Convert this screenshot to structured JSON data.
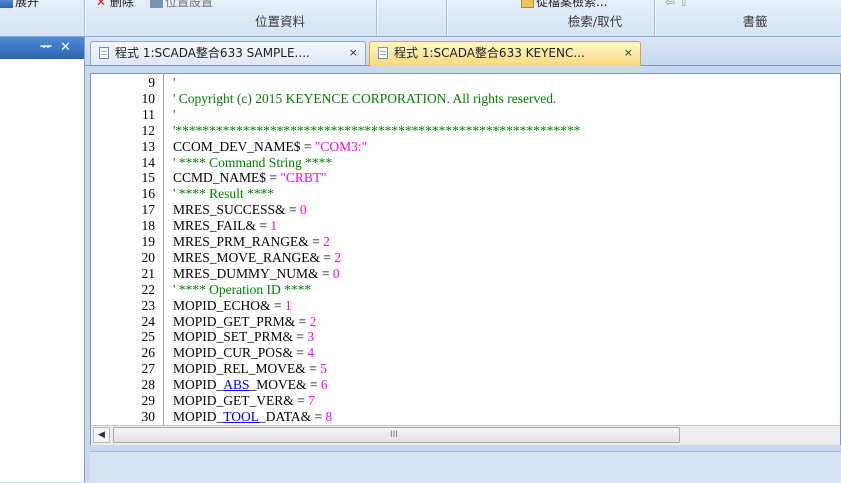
{
  "ribbon": {
    "expand_label": "展开",
    "delete_label": "删除",
    "set_position_label": "位置設置",
    "bookmark_label": "從檔案檢索...",
    "group_position": "位置資料",
    "group_search": "檢索/取代",
    "group_bookmark": "書籤"
  },
  "left_pane": {
    "pin_label": "ᅲ",
    "close_label": "✕"
  },
  "tabs": [
    {
      "title": "程式 1:SCADA整合633 SAMPLE....",
      "close": "×",
      "active": false
    },
    {
      "title": "程式 1:SCADA整合633 KEYENC...",
      "close": "×",
      "active": true
    }
  ],
  "editor": {
    "lines": [
      {
        "n": "9",
        "tokens": [
          {
            "t": "'",
            "c": "comment"
          }
        ]
      },
      {
        "n": "10",
        "tokens": [
          {
            "t": "' Copyright (c) 2015 KEYENCE CORPORATION. All rights reserved.",
            "c": "comment"
          }
        ]
      },
      {
        "n": "11",
        "tokens": [
          {
            "t": "'",
            "c": "comment"
          }
        ]
      },
      {
        "n": "12",
        "tokens": [
          {
            "t": "'************************************************************",
            "c": "comment"
          }
        ]
      },
      {
        "n": "13",
        "tokens": [
          {
            "t": "CCOM_DEV_NAME$ = ",
            "c": "plain"
          },
          {
            "t": "\"COM3:\"",
            "c": "string"
          }
        ]
      },
      {
        "n": "14",
        "tokens": [
          {
            "t": "' **** Command String ****",
            "c": "comment"
          }
        ]
      },
      {
        "n": "15",
        "tokens": [
          {
            "t": "CCMD_NAME$ = ",
            "c": "plain"
          },
          {
            "t": "\"CRBT\"",
            "c": "string"
          }
        ]
      },
      {
        "n": "16",
        "tokens": [
          {
            "t": "' **** Result ****",
            "c": "comment"
          }
        ]
      },
      {
        "n": "17",
        "tokens": [
          {
            "t": "MRES_SUCCESS& = ",
            "c": "plain"
          },
          {
            "t": "0",
            "c": "number"
          }
        ]
      },
      {
        "n": "18",
        "tokens": [
          {
            "t": "MRES_FAIL& = ",
            "c": "plain"
          },
          {
            "t": "1",
            "c": "number"
          }
        ]
      },
      {
        "n": "19",
        "tokens": [
          {
            "t": "MRES_PRM_RANGE& = ",
            "c": "plain"
          },
          {
            "t": "2",
            "c": "number"
          }
        ]
      },
      {
        "n": "20",
        "tokens": [
          {
            "t": "MRES_MOVE_RANGE& = ",
            "c": "plain"
          },
          {
            "t": "2",
            "c": "number"
          }
        ]
      },
      {
        "n": "21",
        "tokens": [
          {
            "t": "MRES_DUMMY_NUM& = ",
            "c": "plain"
          },
          {
            "t": "0",
            "c": "number"
          }
        ]
      },
      {
        "n": "22",
        "tokens": [
          {
            "t": "' **** Operation ID ****",
            "c": "comment"
          }
        ]
      },
      {
        "n": "23",
        "tokens": [
          {
            "t": "MOPID_ECHO& = ",
            "c": "plain"
          },
          {
            "t": "1",
            "c": "number"
          }
        ]
      },
      {
        "n": "24",
        "tokens": [
          {
            "t": "MOPID_GET_PRM& = ",
            "c": "plain"
          },
          {
            "t": "2",
            "c": "number"
          }
        ]
      },
      {
        "n": "25",
        "tokens": [
          {
            "t": "MOPID_SET_PRM& = ",
            "c": "plain"
          },
          {
            "t": "3",
            "c": "number"
          }
        ]
      },
      {
        "n": "26",
        "tokens": [
          {
            "t": "MOPID_CUR_POS& = ",
            "c": "plain"
          },
          {
            "t": "4",
            "c": "number"
          }
        ]
      },
      {
        "n": "27",
        "tokens": [
          {
            "t": "MOPID_REL_MOVE& = ",
            "c": "plain"
          },
          {
            "t": "5",
            "c": "number"
          }
        ]
      },
      {
        "n": "28",
        "tokens": [
          {
            "t": "MOPID_",
            "c": "plain"
          },
          {
            "t": "ABS",
            "c": "kw"
          },
          {
            "t": "_MOVE& = ",
            "c": "plain"
          },
          {
            "t": "6",
            "c": "number"
          }
        ]
      },
      {
        "n": "29",
        "tokens": [
          {
            "t": "MOPID_GET_VER& = ",
            "c": "plain"
          },
          {
            "t": "7",
            "c": "number"
          }
        ]
      },
      {
        "n": "30",
        "tokens": [
          {
            "t": "MOPID_",
            "c": "plain"
          },
          {
            "t": "TOOL",
            "c": "kw"
          },
          {
            "t": "_DATA& = ",
            "c": "plain"
          },
          {
            "t": "8",
            "c": "number"
          }
        ]
      }
    ]
  },
  "scrollbar": {
    "left_arrow": "◀",
    "grip": "III"
  },
  "colors": {
    "comment": "#008000",
    "string": "#ff00ff",
    "keyword": "#0000ff",
    "active_tab": "#f9d978",
    "pane_header": "#2e63b2"
  }
}
